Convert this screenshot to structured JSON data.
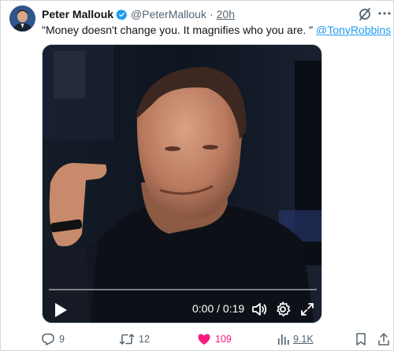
{
  "author": {
    "name": "Peter Mallouk",
    "handle": "@PeterMallouk",
    "separator": "·",
    "time": "20h"
  },
  "tweet": {
    "text": "\"Money doesn't change you. It magnifies who you are. \" ",
    "mention": "@TonyRobbins"
  },
  "video": {
    "timecode": "0:00 / 0:19",
    "progress": 0
  },
  "actions": {
    "replies": "9",
    "retweets": "12",
    "likes": "109",
    "views": "9.1K"
  },
  "colors": {
    "accent": "#1d9bf0",
    "like": "#f91880",
    "muted": "#536471",
    "text": "#0f1419"
  },
  "icons": {
    "verified": "verified-badge-icon",
    "grok": "grok-icon",
    "more": "more-icon",
    "play": "play-icon",
    "volume": "volume-icon",
    "settings": "gear-icon",
    "fullscreen": "fullscreen-icon",
    "reply": "reply-icon",
    "retweet": "retweet-icon",
    "like": "heart-icon",
    "views": "views-icon",
    "bookmark": "bookmark-icon",
    "share": "share-icon"
  }
}
